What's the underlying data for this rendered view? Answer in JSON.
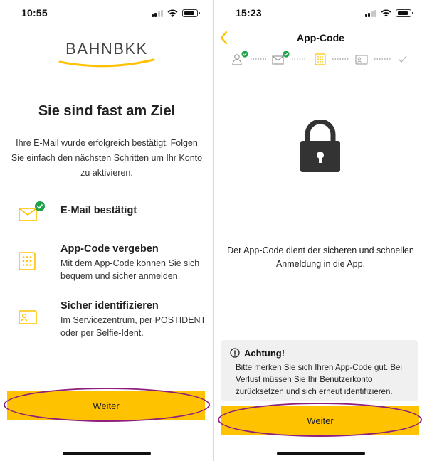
{
  "left": {
    "status_time": "10:55",
    "logo": {
      "part1": "BAHN",
      "part2": "BKK"
    },
    "title": "Sie sind fast am Ziel",
    "intro": "Ihre E-Mail wurde erfolgreich bestätigt. Folgen Sie einfach den nächsten Schritten um Ihr Konto zu aktivieren.",
    "steps": [
      {
        "title": "E-Mail bestätigt",
        "description": "",
        "icon": "envelope-icon",
        "done": true
      },
      {
        "title": "App-Code vergeben",
        "description": "Mit dem App-Code können Sie sich bequem und sicher anmelden.",
        "icon": "keypad-icon",
        "done": false
      },
      {
        "title": "Sicher identifizieren",
        "description": "Im Servicezentrum, per POSTIDENT oder per Selfie-Ident.",
        "icon": "id-card-icon",
        "done": false
      }
    ],
    "button_label": "Weiter"
  },
  "right": {
    "status_time": "15:23",
    "nav_title": "App-Code",
    "progress_steps": [
      {
        "icon": "person-icon",
        "done": true
      },
      {
        "icon": "envelope-icon",
        "done": true
      },
      {
        "icon": "keypad-icon",
        "done": false,
        "active": true
      },
      {
        "icon": "id-card-icon",
        "done": false
      },
      {
        "icon": "checkmark-icon",
        "done": false
      }
    ],
    "description": "Der App-Code dient der sicheren und schnellen Anmeldung in die App.",
    "notice": {
      "title": "Achtung!",
      "body": "Bitte merken Sie sich Ihren App-Code gut. Bei Verlust müssen Sie Ihr Benutzerkonto zurücksetzen und sich erneut identifizieren."
    },
    "button_label": "Weiter"
  },
  "colors": {
    "accent_yellow": "#ffc200",
    "success_green": "#1fa34a",
    "highlight_purple": "#8e1f7e",
    "lock_gray": "#333333",
    "notice_bg": "#f0f0f0"
  }
}
